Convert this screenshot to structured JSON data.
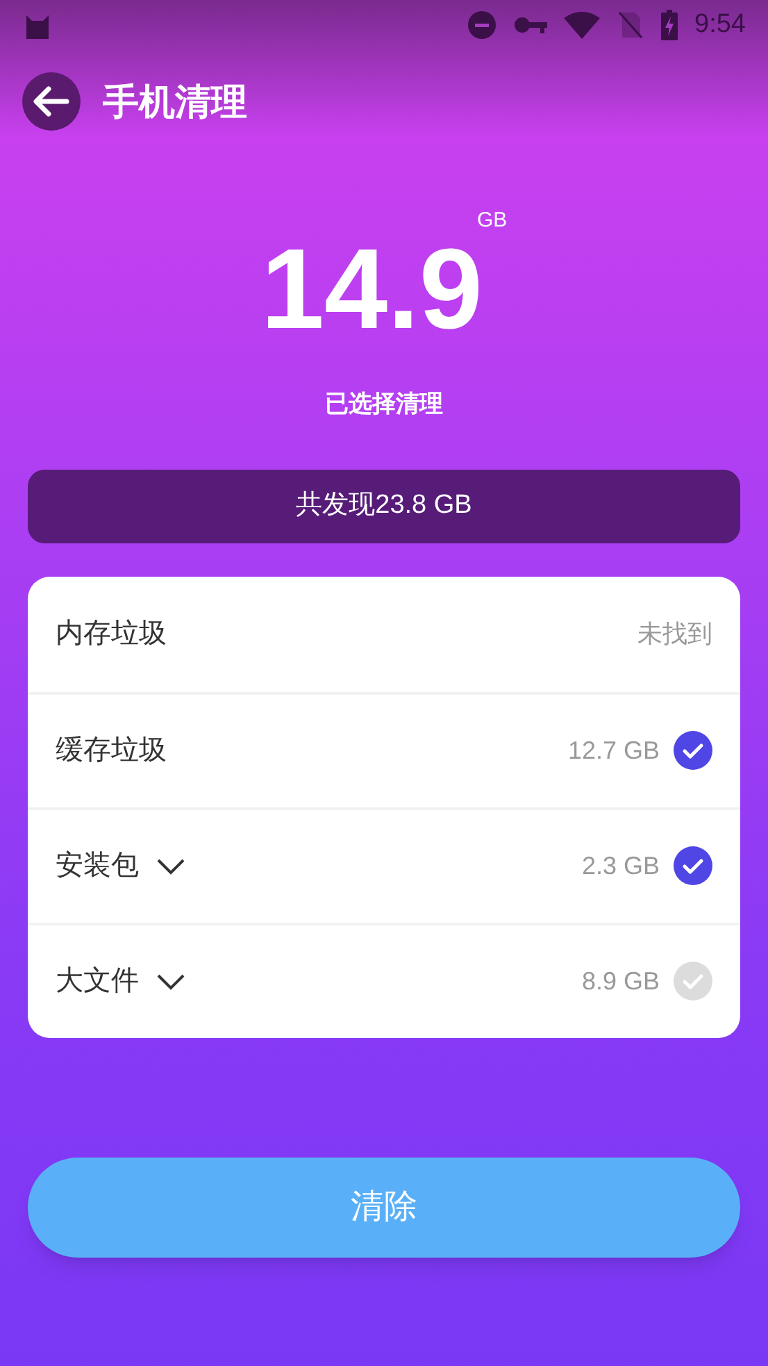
{
  "status_bar": {
    "time": "9:54"
  },
  "header": {
    "title": "手机清理"
  },
  "summary": {
    "amount": "14.9",
    "unit": "GB",
    "caption": "已选择清理"
  },
  "found_bar": {
    "text": "共发现23.8 GB"
  },
  "items": [
    {
      "kind": "status",
      "label": "内存垃圾",
      "value": "未找到",
      "expandable": false
    },
    {
      "kind": "checkable",
      "label": "缓存垃圾",
      "value": "12.7 GB",
      "checked": true,
      "expandable": false
    },
    {
      "kind": "checkable",
      "label": "安装包",
      "value": "2.3 GB",
      "checked": true,
      "expandable": true
    },
    {
      "kind": "checkable",
      "label": "大文件",
      "value": "8.9 GB",
      "checked": false,
      "expandable": true
    }
  ],
  "clean_button": {
    "label": "清除"
  }
}
